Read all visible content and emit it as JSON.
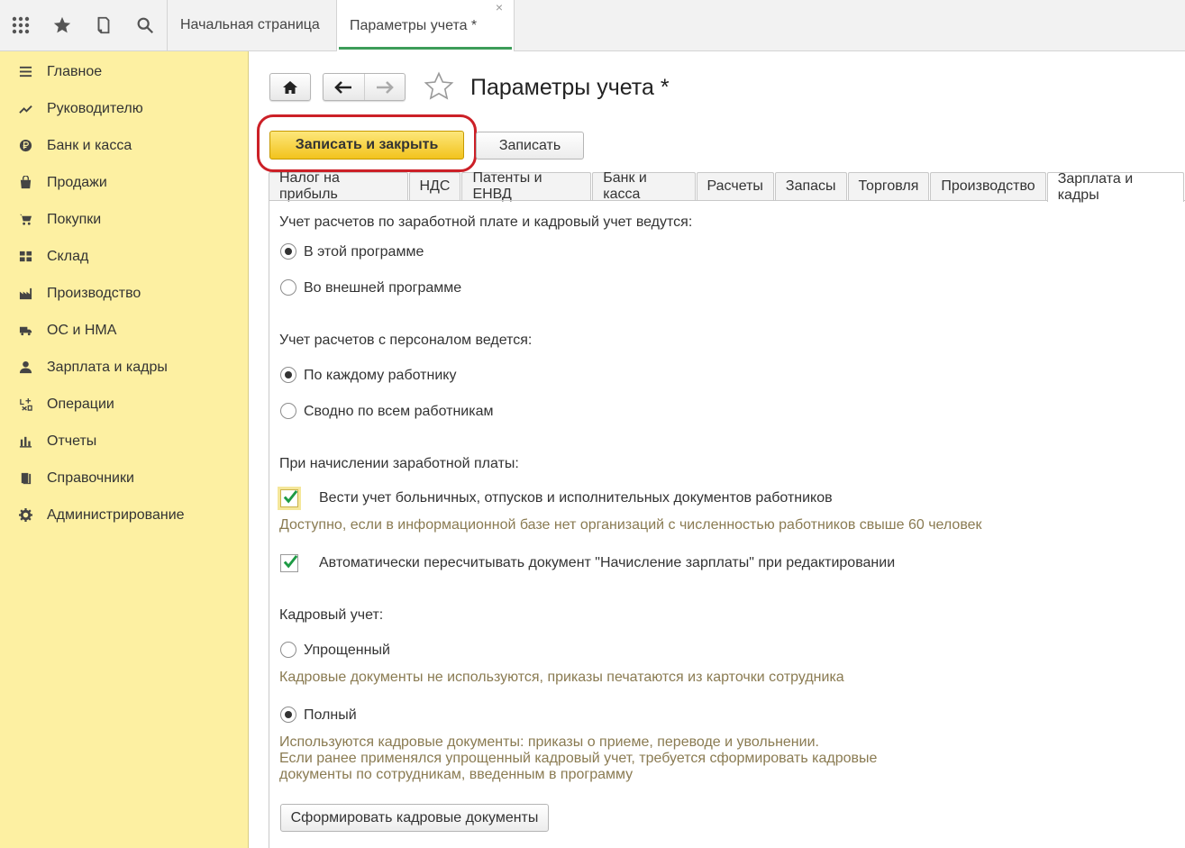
{
  "topbar": {
    "icons": [
      "apps-grid-icon",
      "star-icon",
      "history-icon",
      "search-icon"
    ],
    "tabs": [
      {
        "label": "Начальная страница",
        "active": false
      },
      {
        "label": "Параметры учета *",
        "active": true,
        "close": "×"
      }
    ]
  },
  "sidebar": {
    "items": [
      {
        "label": "Главное",
        "icon": "menu-lines-icon"
      },
      {
        "label": "Руководителю",
        "icon": "trend-icon"
      },
      {
        "label": "Банк и касса",
        "icon": "ruble-coin-icon"
      },
      {
        "label": "Продажи",
        "icon": "shopping-bag-icon"
      },
      {
        "label": "Покупки",
        "icon": "cart-icon"
      },
      {
        "label": "Склад",
        "icon": "warehouse-icon"
      },
      {
        "label": "Производство",
        "icon": "factory-icon"
      },
      {
        "label": "ОС и НМА",
        "icon": "truck-icon"
      },
      {
        "label": "Зарплата и кадры",
        "icon": "person-icon"
      },
      {
        "label": "Операции",
        "icon": "operations-icon"
      },
      {
        "label": "Отчеты",
        "icon": "bar-chart-icon"
      },
      {
        "label": "Справочники",
        "icon": "book-icon"
      },
      {
        "label": "Администрирование",
        "icon": "gear-icon"
      }
    ]
  },
  "header": {
    "title": "Параметры учета *",
    "save_close": "Записать и закрыть",
    "save": "Записать"
  },
  "tabs": [
    {
      "label": "Налог на прибыль",
      "active": false
    },
    {
      "label": "НДС",
      "active": false
    },
    {
      "label": "Патенты и ЕНВД",
      "active": false
    },
    {
      "label": "Банк и касса",
      "active": false
    },
    {
      "label": "Расчеты",
      "active": false
    },
    {
      "label": "Запасы",
      "active": false
    },
    {
      "label": "Торговля",
      "active": false
    },
    {
      "label": "Производство",
      "active": false
    },
    {
      "label": "Зарплата и кадры",
      "active": true
    }
  ],
  "form": {
    "payroll_label": "Учет расчетов по заработной плате и кадровый учет ведутся:",
    "payroll_options": [
      {
        "label": "В этой программе",
        "selected": true
      },
      {
        "label": "Во внешней программе",
        "selected": false
      }
    ],
    "personnel_label": "Учет расчетов с персоналом ведется:",
    "personnel_options": [
      {
        "label": "По каждому работнику",
        "selected": true
      },
      {
        "label": "Сводно по всем работникам",
        "selected": false
      }
    ],
    "accrual_label": "При начислении заработной платы:",
    "check_sick": {
      "label": "Вести учет больничных, отпусков и исполнительных документов работников",
      "checked": true
    },
    "check_sick_hint": "Доступно, если в информационной базе нет организаций с численностью работников свыше 60 человек",
    "check_recalc": {
      "label": "Автоматически пересчитывать документ \"Начисление зарплаты\" при редактировании",
      "checked": true
    },
    "hr_label": "Кадровый учет:",
    "hr_simple": {
      "label": "Упрощенный",
      "selected": false
    },
    "hr_simple_hint": "Кадровые документы не используются, приказы печатаются из карточки сотрудника",
    "hr_full": {
      "label": "Полный",
      "selected": true
    },
    "hr_full_hint": [
      "Используются кадровые документы: приказы о приеме, переводе и увольнении.",
      "Если ранее применялся упрощенный кадровый учет, требуется сформировать кадровые",
      "документы по сотрудникам, введенным в программу"
    ],
    "generate_button": "Сформировать кадровые документы"
  },
  "colors": {
    "sidebar_bg": "#fdf0a2",
    "primary_button": "#f5cc2b",
    "highlight_ring": "#cc2027",
    "hint_text": "#8a7b52",
    "check_mark": "#1d9a44",
    "active_tab_underline": "#3d9c59"
  }
}
